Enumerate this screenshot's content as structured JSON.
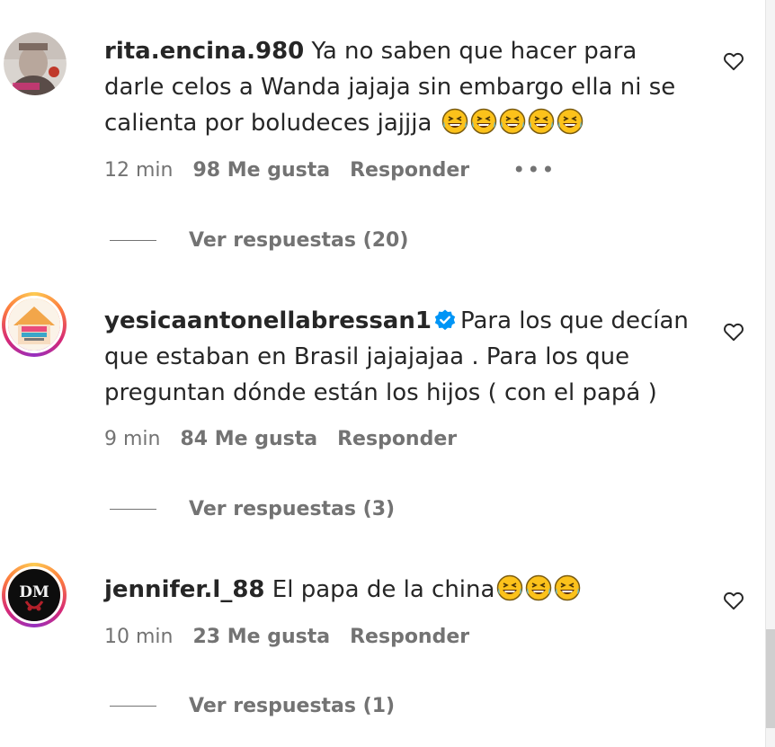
{
  "colors": {
    "text": "#262626",
    "secondary": "#737373",
    "verified": "#0095f6",
    "background": "#ffffff"
  },
  "comments": [
    {
      "username": "rita.encina.980",
      "verified": false,
      "text": "Ya no saben que hacer para darle celos a Wanda jajaja sin embargo ella ni se calienta por boludeces jajjja",
      "emoji_count": 5,
      "emoji": "grinning-squinting-face-icon",
      "time": "12 min",
      "likes": "98 Me gusta",
      "reply_label": "Responder",
      "more_label": "•••",
      "view_replies": "Ver respuestas (20)",
      "like_icon": "heart-icon"
    },
    {
      "username": "yesicaantonellabressan1",
      "verified": true,
      "text": "Para los que decían que estaban en Brasil jajajajaa . Para los que preguntan dónde están los hijos ( con el papá )",
      "emoji_count": 0,
      "time": "9 min",
      "likes": "84 Me gusta",
      "reply_label": "Responder",
      "view_replies": "Ver respuestas (3)",
      "like_icon": "heart-icon"
    },
    {
      "username": "jennifer.l_88",
      "verified": false,
      "text": "El papa de la china",
      "emoji_count": 3,
      "emoji": "grinning-squinting-face-icon",
      "time": "10 min",
      "likes": "23 Me gusta",
      "reply_label": "Responder",
      "view_replies": "Ver respuestas (1)",
      "like_icon": "heart-icon"
    }
  ]
}
